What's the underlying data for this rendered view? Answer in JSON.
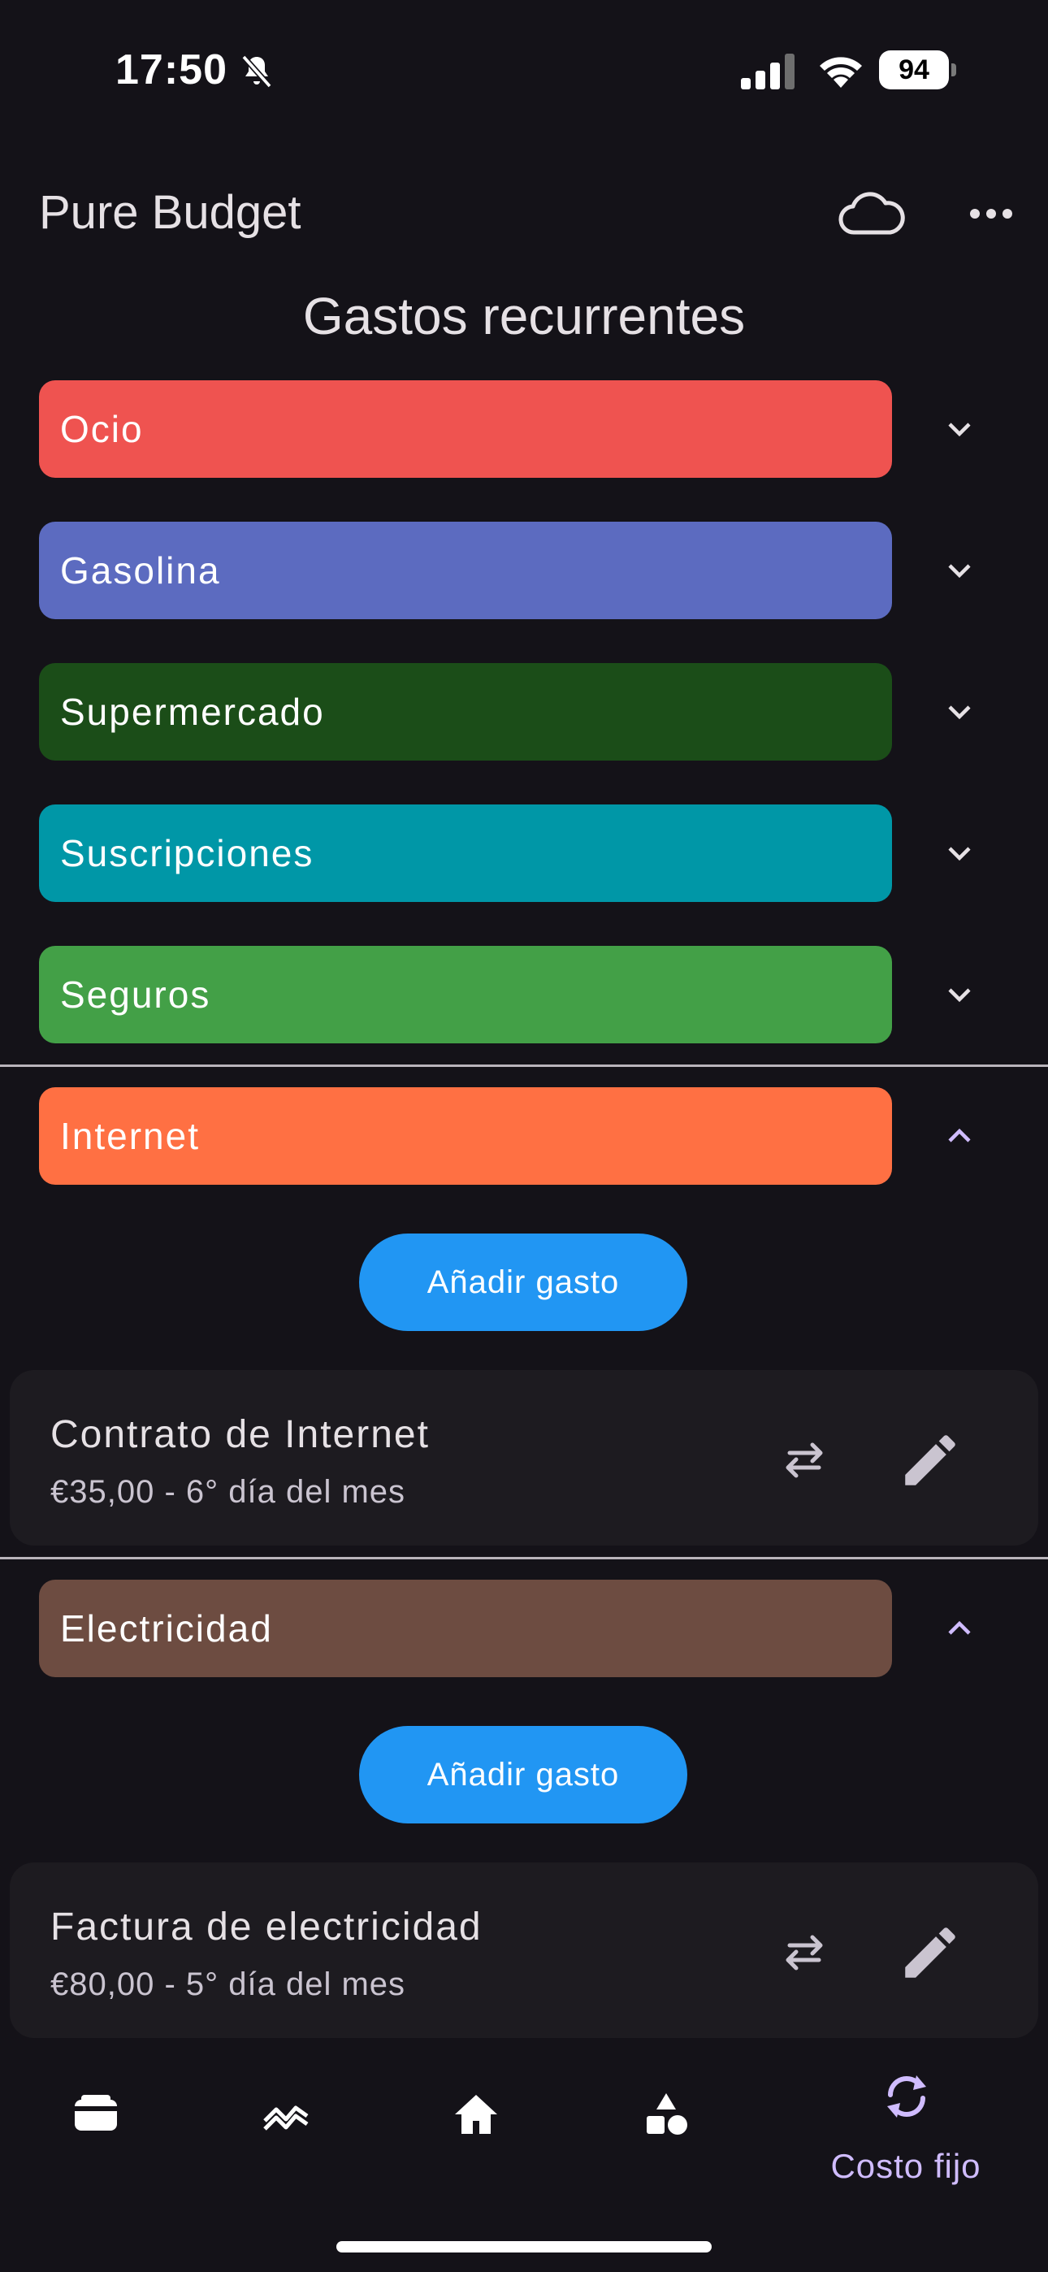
{
  "status": {
    "time": "17:50",
    "battery": "94"
  },
  "app": {
    "title": "Pure Budget",
    "heading": "Gastos recurrentes"
  },
  "categories": [
    {
      "label": "Ocio",
      "color": "#ef5350",
      "expanded": false
    },
    {
      "label": "Gasolina",
      "color": "#5c6bc0",
      "expanded": false
    },
    {
      "label": "Supermercado",
      "color": "#1b4d18",
      "expanded": false
    },
    {
      "label": "Suscripciones",
      "color": "#0097a7",
      "expanded": false
    },
    {
      "label": "Seguros",
      "color": "#43a047",
      "expanded": false
    },
    {
      "label": "Internet",
      "color": "#ff7043",
      "expanded": true
    },
    {
      "label": "Electricidad",
      "color": "#6d4c41",
      "expanded": true
    }
  ],
  "internet_section": {
    "add_label": "Añadir gasto",
    "expense": {
      "name": "Contrato de Internet",
      "detail": "€35,00 - 6° día del mes"
    }
  },
  "electricity_section": {
    "add_label": "Añadir gasto",
    "expense": {
      "name": "Factura de electricidad",
      "detail": "€80,00 - 5° día del mes"
    }
  },
  "bottom_nav": {
    "items": [
      {
        "icon": "wallet-icon"
      },
      {
        "icon": "trend-icon"
      },
      {
        "icon": "home-icon"
      },
      {
        "icon": "shapes-icon"
      },
      {
        "icon": "sync-icon",
        "label": "Costo fijo",
        "active": true
      }
    ]
  },
  "colors": {
    "background": "#141218",
    "accent": "#d0bcff",
    "button": "#2196f3"
  }
}
